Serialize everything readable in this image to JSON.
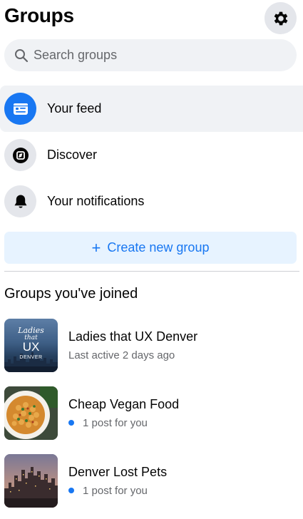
{
  "header": {
    "title": "Groups",
    "settings_icon": "gear-icon"
  },
  "search": {
    "placeholder": "Search groups",
    "value": "",
    "icon": "search-icon"
  },
  "nav": [
    {
      "label": "Your feed",
      "icon": "feed-icon",
      "active": true
    },
    {
      "label": "Discover",
      "icon": "compass-icon",
      "active": false
    },
    {
      "label": "Your notifications",
      "icon": "bell-icon",
      "active": false
    }
  ],
  "create": {
    "label": "Create new group",
    "icon": "plus-icon"
  },
  "joined": {
    "title": "Groups you've joined",
    "groups": [
      {
        "name": "Ladies that UX Denver",
        "subtitle": "Last active 2 days ago",
        "has_dot": false,
        "thumb_text": {
          "line1": "Ladies",
          "line2": "that",
          "line3": "UX",
          "line4": "DENVER"
        }
      },
      {
        "name": "Cheap Vegan Food",
        "subtitle": "1 post for you",
        "has_dot": true
      },
      {
        "name": "Denver Lost Pets",
        "subtitle": "1 post for you",
        "has_dot": true
      }
    ]
  },
  "colors": {
    "accent": "#1877f2",
    "accent_light": "#e7f3ff",
    "surface": "#f0f2f5",
    "icon_bg": "#e4e6eb",
    "secondary_text": "#65676b"
  }
}
